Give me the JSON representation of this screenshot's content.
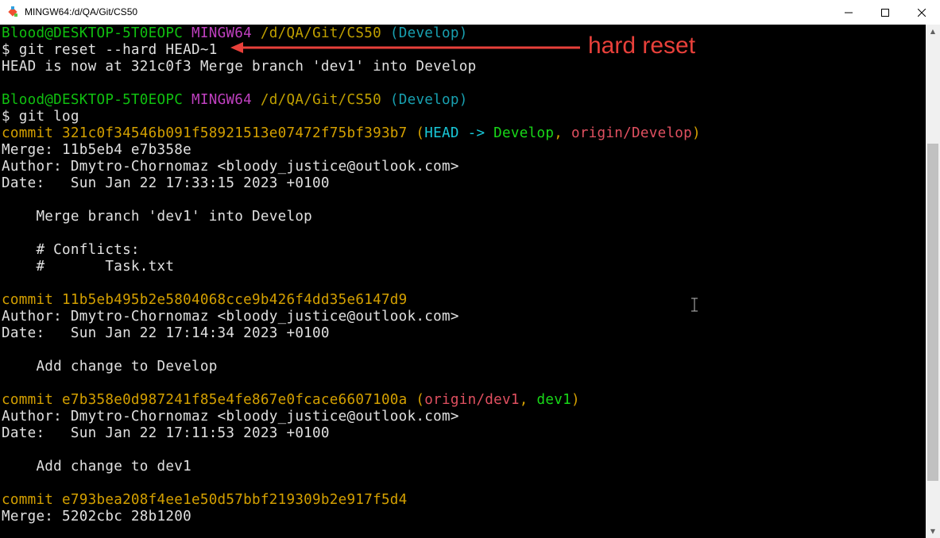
{
  "window": {
    "title": "MINGW64:/d/QA/Git/CS50",
    "controls": {
      "minimize": "—",
      "maximize": "☐",
      "close": "✕"
    }
  },
  "annotation": {
    "text": "hard reset",
    "color": "#e8403a"
  },
  "terminal": {
    "lines": [
      {
        "segments": [
          {
            "text": "Blood@DESKTOP-5T0EOPC",
            "color": "green"
          },
          {
            "text": " ",
            "color": "white"
          },
          {
            "text": "MINGW64",
            "color": "magenta"
          },
          {
            "text": " ",
            "color": "white"
          },
          {
            "text": "/d/QA/Git/CS50",
            "color": "yellow"
          },
          {
            "text": " ",
            "color": "white"
          },
          {
            "text": "(Develop)",
            "color": "teal"
          }
        ]
      },
      {
        "segments": [
          {
            "text": "$ git reset --hard HEAD~1",
            "color": "white"
          }
        ]
      },
      {
        "segments": [
          {
            "text": "HEAD is now at 321c0f3 Merge branch 'dev1' into Develop",
            "color": "white"
          }
        ]
      },
      {
        "segments": [
          {
            "text": "",
            "color": "white"
          }
        ]
      },
      {
        "segments": [
          {
            "text": "Blood@DESKTOP-5T0EOPC",
            "color": "green"
          },
          {
            "text": " ",
            "color": "white"
          },
          {
            "text": "MINGW64",
            "color": "magenta"
          },
          {
            "text": " ",
            "color": "white"
          },
          {
            "text": "/d/QA/Git/CS50",
            "color": "yellow"
          },
          {
            "text": " ",
            "color": "white"
          },
          {
            "text": "(Develop)",
            "color": "teal"
          }
        ]
      },
      {
        "segments": [
          {
            "text": "$ git log",
            "color": "white"
          }
        ]
      },
      {
        "segments": [
          {
            "text": "commit 321c0f34546b091f58921513e07472f75bf393b7",
            "color": "orange"
          },
          {
            "text": " (",
            "color": "orange"
          },
          {
            "text": "HEAD -> ",
            "color": "cyan"
          },
          {
            "text": "Develop",
            "color": "bgreen"
          },
          {
            "text": ", ",
            "color": "orange"
          },
          {
            "text": "origin/Develop",
            "color": "red"
          },
          {
            "text": ")",
            "color": "orange"
          }
        ]
      },
      {
        "segments": [
          {
            "text": "Merge: 11b5eb4 e7b358e",
            "color": "white"
          }
        ]
      },
      {
        "segments": [
          {
            "text": "Author: Dmytro-Chornomaz <bloody_justice@outlook.com>",
            "color": "white"
          }
        ]
      },
      {
        "segments": [
          {
            "text": "Date:   Sun Jan 22 17:33:15 2023 +0100",
            "color": "white"
          }
        ]
      },
      {
        "segments": [
          {
            "text": "",
            "color": "white"
          }
        ]
      },
      {
        "segments": [
          {
            "text": "    Merge branch 'dev1' into Develop",
            "color": "white"
          }
        ]
      },
      {
        "segments": [
          {
            "text": "",
            "color": "white"
          }
        ]
      },
      {
        "segments": [
          {
            "text": "    # Conflicts:",
            "color": "white"
          }
        ]
      },
      {
        "segments": [
          {
            "text": "    #       Task.txt",
            "color": "white"
          }
        ]
      },
      {
        "segments": [
          {
            "text": "",
            "color": "white"
          }
        ]
      },
      {
        "segments": [
          {
            "text": "commit 11b5eb495b2e5804068cce9b426f4dd35e6147d9",
            "color": "orange"
          }
        ]
      },
      {
        "segments": [
          {
            "text": "Author: Dmytro-Chornomaz <bloody_justice@outlook.com>",
            "color": "white"
          }
        ]
      },
      {
        "segments": [
          {
            "text": "Date:   Sun Jan 22 17:14:34 2023 +0100",
            "color": "white"
          }
        ]
      },
      {
        "segments": [
          {
            "text": "",
            "color": "white"
          }
        ]
      },
      {
        "segments": [
          {
            "text": "    Add change to Develop",
            "color": "white"
          }
        ]
      },
      {
        "segments": [
          {
            "text": "",
            "color": "white"
          }
        ]
      },
      {
        "segments": [
          {
            "text": "commit e7b358e0d987241f85e4fe867e0fcace6607100a",
            "color": "orange"
          },
          {
            "text": " (",
            "color": "orange"
          },
          {
            "text": "origin/dev1",
            "color": "red"
          },
          {
            "text": ", ",
            "color": "orange"
          },
          {
            "text": "dev1",
            "color": "bgreen"
          },
          {
            "text": ")",
            "color": "orange"
          }
        ]
      },
      {
        "segments": [
          {
            "text": "Author: Dmytro-Chornomaz <bloody_justice@outlook.com>",
            "color": "white"
          }
        ]
      },
      {
        "segments": [
          {
            "text": "Date:   Sun Jan 22 17:11:53 2023 +0100",
            "color": "white"
          }
        ]
      },
      {
        "segments": [
          {
            "text": "",
            "color": "white"
          }
        ]
      },
      {
        "segments": [
          {
            "text": "    Add change to dev1",
            "color": "white"
          }
        ]
      },
      {
        "segments": [
          {
            "text": "",
            "color": "white"
          }
        ]
      },
      {
        "segments": [
          {
            "text": "commit e793bea208f4ee1e50d57bbf219309b2e917f5d4",
            "color": "orange"
          }
        ]
      },
      {
        "segments": [
          {
            "text": "Merge: 5202cbc 28b1200",
            "color": "white"
          }
        ]
      }
    ]
  }
}
